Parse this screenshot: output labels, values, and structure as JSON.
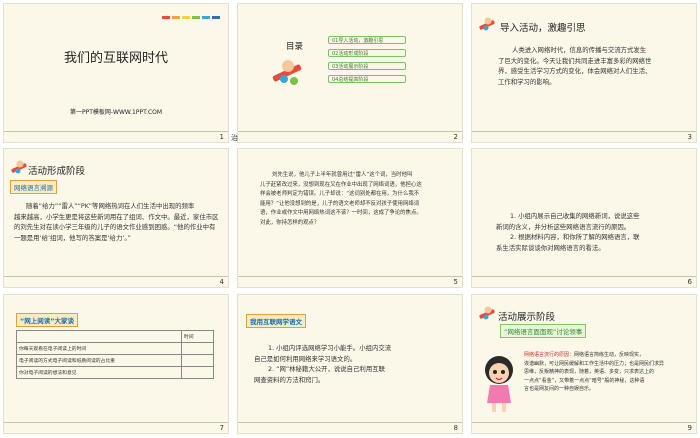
{
  "slides": [
    {
      "number": "1",
      "title": "我们的互联网时代",
      "subtitle": "第一PPT模板网-WWW.1PPT.COM"
    },
    {
      "number": "2",
      "corner_text": "治",
      "toc_title": "目录",
      "toc_items": [
        "01导入活动，激趣引思",
        "02活动形成阶段",
        "03活动展示阶段",
        "04总结提高阶段"
      ]
    },
    {
      "number": "3",
      "heading": "导入活动，激趣引思",
      "lines": [
        "人类进入网络时代，信息的传播与交流方式发生",
        "了巨大的变化。今天让我们共同走进丰富多彩的网络世",
        "界，感受生活学习方式的变化，体会网络对人们生活、",
        "工作和学习的影响。"
      ]
    },
    {
      "number": "4",
      "heading": "活动形成阶段",
      "tag": "网络语言溯源",
      "lines": [
        "随着“给力”“雷人”“PK”等网络热词在人们生活中出现的频率",
        "越来越高，小学生更是将这些新词用在了组词、作文中。最近，家住市区",
        "的刘先生对在读小学三年级的儿子的语文作业感到困惑。“他的作业中有",
        "一题是用‘给’组词，他写的答案是‘给力’。”"
      ]
    },
    {
      "number": "5",
      "lines": [
        "刘先生说，他儿子上半年就曾用过“雷人”这个词，当时他叫",
        "儿子赶紧改过来，没想到现在又在作业中出现了网络词语，他担心这",
        "样会被老师判定为错误。儿子却说：“这词别处都在用，为什么我不",
        "能用？”让他没想到的是，儿子的语文老师却不反对孩子使用网络词",
        "语，作业或作文中用网络热词这不该？一时间，这成了争论的焦点。",
        "对此，你持怎样的观点？"
      ]
    },
    {
      "number": "6",
      "lines": [
        "1. 小组内展示自己收集的网络新词，说说这些",
        "新词的含义，并分析这些网络语言流行的原因。",
        "2. 根据材料内容，和你所了解的网络语言，联",
        "系生活实际谈谈你对网络语言的看法。"
      ]
    },
    {
      "number": "7",
      "tag": "“网上阅读”大家谈",
      "table_header": [
        "",
        "时间"
      ],
      "table_rows": [
        "你每天观看在电子阅读上的时间",
        "电子阅读的方式电子阅读和纸质阅读的占比重",
        "你对电子阅读的想法和意见"
      ]
    },
    {
      "number": "8",
      "tag": "我用互联网学语文",
      "lines": [
        "1. 小组内评选网络学习小能手。小组内交流",
        "自己是如何利用网络来学习语文的。",
        "2. “网”林秘籍大公开，说说自己利用互联",
        "网查资料的方法和窍门。"
      ]
    },
    {
      "number": "9",
      "heading": "活动展示阶段",
      "tag": "“网络语言面面观”讨论领事",
      "highlight": "网络语言流行的原因：",
      "lines": [
        "网络语言简练生动，反映现实，",
        "诙谐幽默，可让网民缓解和工作生活中的压力；也是网民们求异",
        "思维，反叛精神的表现，随着，英语、多变，只求表达上的",
        "一点点“看金”，又带着一点点“暗号”般的神秘，这种语",
        "言也是网友间的一种自娱自乐。"
      ]
    }
  ],
  "colors": {
    "slide_bg": "#fbf8e9",
    "accent_orange": "#e88a2e",
    "accent_green": "#5aa83a",
    "accent_blue": "#3d7ec8",
    "tag_border": "#e0a33a",
    "highlight_red": "#c4302b"
  }
}
